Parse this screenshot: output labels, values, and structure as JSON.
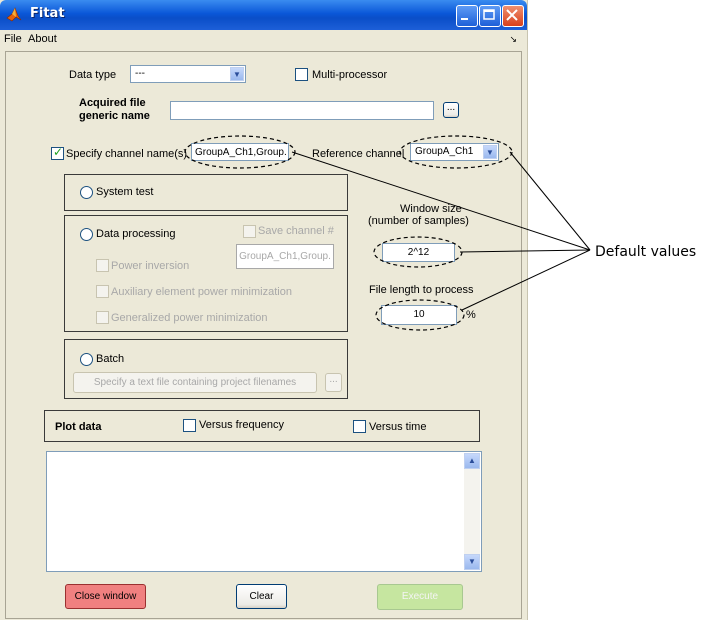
{
  "window": {
    "title": "Fitat",
    "menu": [
      "File",
      "About"
    ],
    "menu_arrow": "↘"
  },
  "data_type": {
    "label": "Data type",
    "value": "---"
  },
  "multiprocessor_label": "Multi-processor",
  "acquired_file": {
    "label_line1": "Acquired file",
    "label_line2": "generic name",
    "value": "",
    "browse_label": "..."
  },
  "specify_channel": {
    "label": "Specify channel name(s)",
    "value": "GroupA_Ch1,Group."
  },
  "reference_channel": {
    "label": "Reference channel",
    "value": "GroupA_Ch1"
  },
  "system_test_label": "System test",
  "data_processing": {
    "label": "Data processing",
    "save_channel_label": "Save channel #",
    "save_channel_value": "GroupA_Ch1,Group.",
    "options": [
      "Power inversion",
      "Auxiliary element power minimization",
      "Generalized power minimization"
    ]
  },
  "window_size": {
    "label_line1": "Window size",
    "label_line2": "(number of samples)",
    "value": "2^12"
  },
  "file_length": {
    "label": "File length to process",
    "value": "10",
    "unit": "%"
  },
  "batch": {
    "label": "Batch",
    "specify_file_label": "Specify a text file containing project filenames",
    "browse_label": "..."
  },
  "plot_data": {
    "label": "Plot data",
    "versus_frequency": "Versus frequency",
    "versus_time": "Versus time"
  },
  "buttons": {
    "close": "Close window",
    "clear": "Clear",
    "execute": "Execute"
  },
  "annotation": "Default values",
  "colors": {
    "close_button": "#f08080",
    "execute_button": "#c6e6a0",
    "titlebar": "#0a57d8"
  }
}
